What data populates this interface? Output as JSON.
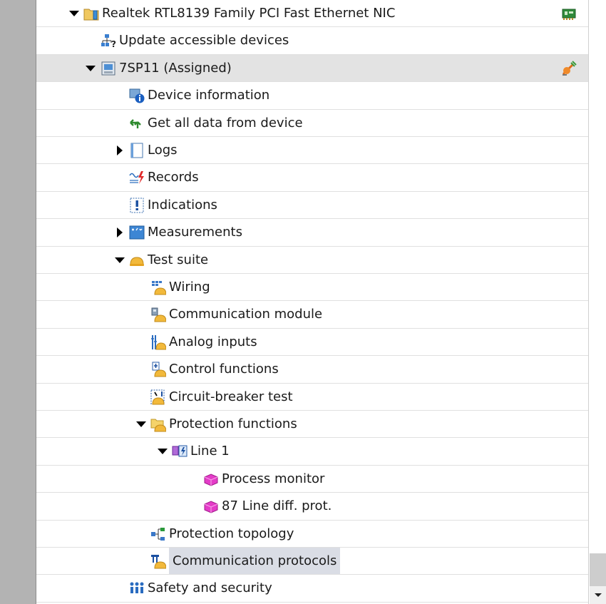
{
  "tree": {
    "items": [
      {
        "label": "Realtek RTL8139 Family PCI Fast Ethernet NIC",
        "icon": "folder-network-icon",
        "expanded": true
      },
      {
        "label": "Update accessible devices",
        "icon": "update-devices-icon"
      },
      {
        "label": "7SP11 (Assigned)",
        "icon": "device-icon",
        "expanded": true,
        "status_icon": "online-connection-icon"
      },
      {
        "label": "Device information",
        "icon": "info-icon"
      },
      {
        "label": "Get all data from device",
        "icon": "get-data-icon"
      },
      {
        "label": "Logs",
        "icon": "logs-icon",
        "expanded": false
      },
      {
        "label": "Records",
        "icon": "records-icon"
      },
      {
        "label": "Indications",
        "icon": "indications-icon"
      },
      {
        "label": "Measurements",
        "icon": "measurements-icon",
        "expanded": false
      },
      {
        "label": "Test suite",
        "icon": "test-suite-icon",
        "expanded": true
      },
      {
        "label": "Wiring",
        "icon": "wiring-icon"
      },
      {
        "label": "Communication module",
        "icon": "communication-module-icon"
      },
      {
        "label": "Analog inputs",
        "icon": "analog-inputs-icon"
      },
      {
        "label": "Control functions",
        "icon": "control-functions-icon"
      },
      {
        "label": "Circuit-breaker test",
        "icon": "circuit-breaker-icon"
      },
      {
        "label": "Protection functions",
        "icon": "protection-functions-icon",
        "expanded": true
      },
      {
        "label": "Line 1",
        "icon": "line-icon",
        "expanded": true
      },
      {
        "label": "Process monitor",
        "icon": "function-block-icon"
      },
      {
        "label": "87 Line diff. prot.",
        "icon": "function-block-icon"
      },
      {
        "label": "Protection topology",
        "icon": "topology-icon"
      },
      {
        "label": "Communication protocols",
        "icon": "protocols-icon",
        "selected": true
      },
      {
        "label": "Safety and security",
        "icon": "security-icon"
      }
    ]
  },
  "colors": {
    "highlight_row": "#e3e3e3",
    "selected_label": "#dadde5",
    "left_bar": "#b3b3b3",
    "helmet": "#f2b93b",
    "function_block": "#e43cc8"
  }
}
